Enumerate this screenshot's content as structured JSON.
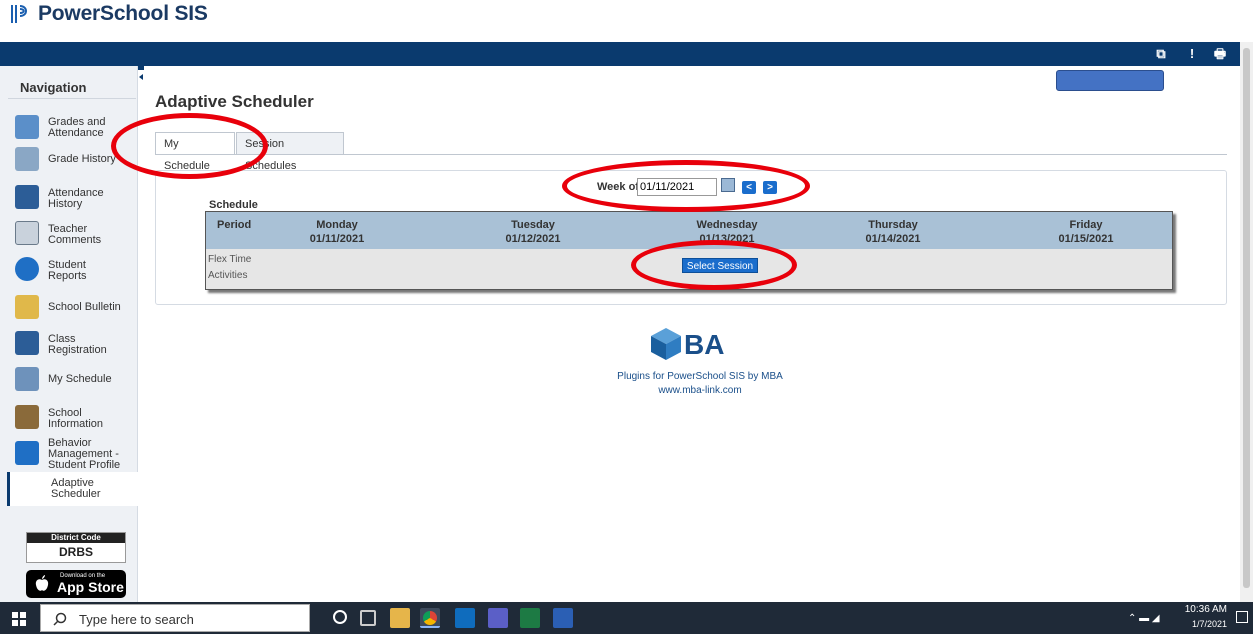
{
  "app": {
    "name": "PowerSchool SIS"
  },
  "toolbar": {
    "icons": [
      "external-link-icon",
      "alert-icon",
      "print-icon"
    ]
  },
  "sidebar": {
    "heading": "Navigation",
    "items": [
      {
        "label": "Grades and\nAttendance",
        "icon": "grades-icon"
      },
      {
        "label": "Grade History",
        "icon": "grade-history-icon"
      },
      {
        "label": "Attendance\nHistory",
        "icon": "attendance-history-icon"
      },
      {
        "label": "Teacher\nComments",
        "icon": "comments-icon"
      },
      {
        "label": "Student\nReports",
        "icon": "reports-icon"
      },
      {
        "label": "School Bulletin",
        "icon": "bulletin-icon"
      },
      {
        "label": "Class\nRegistration",
        "icon": "registration-icon"
      },
      {
        "label": "My Schedule",
        "icon": "schedule-icon"
      },
      {
        "label": "School\nInformation",
        "icon": "school-icon"
      },
      {
        "label": "Behavior\nManagement -\nStudent Profile",
        "icon": "behavior-icon"
      },
      {
        "label": "Adaptive\nScheduler",
        "icon": ""
      }
    ],
    "district": {
      "heading": "District Code",
      "code": "DRBS"
    },
    "appstore": {
      "small": "Download on the",
      "big": "App Store"
    }
  },
  "main": {
    "title": "Adaptive Scheduler",
    "tabs": [
      "My Schedule",
      "Session Schedules"
    ],
    "week_label": "Week of",
    "week_value": "01/11/2021",
    "prev": "<",
    "next": ">",
    "schedule_label": "Schedule",
    "columns": [
      {
        "day": "Period",
        "date": ""
      },
      {
        "day": "Monday",
        "date": "01/11/2021"
      },
      {
        "day": "Tuesday",
        "date": "01/12/2021"
      },
      {
        "day": "Wednesday",
        "date": "01/13/2021"
      },
      {
        "day": "Thursday",
        "date": "01/14/2021"
      },
      {
        "day": "Friday",
        "date": "01/15/2021"
      }
    ],
    "row": {
      "line1": "Flex Time",
      "line2": "Activities",
      "action": "Select Session"
    },
    "footer": {
      "brand": "BA",
      "tagline": "Plugins for PowerSchool SIS by MBA",
      "url": "www.mba-link.com"
    }
  },
  "taskbar": {
    "search_placeholder": "Type here to search",
    "time": "10:36 AM",
    "date": "1/7/2021"
  },
  "colors": {
    "nav_dark": "#0a3a6e",
    "accent": "#1a6dcc",
    "annotation": "#e8000b"
  }
}
